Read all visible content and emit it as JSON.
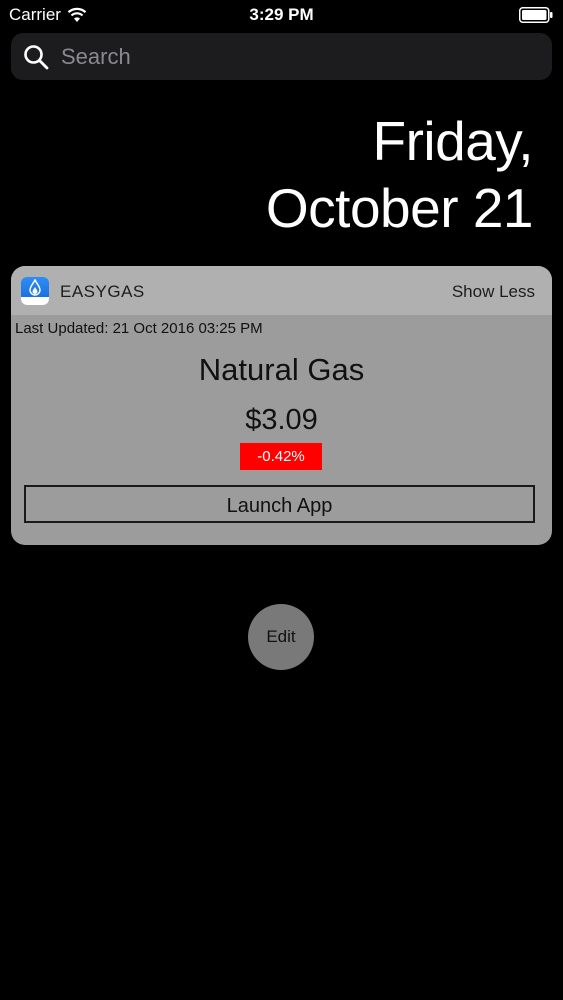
{
  "status_bar": {
    "carrier": "Carrier",
    "time": "3:29 PM",
    "wifi_icon": "wifi-icon",
    "battery_icon": "battery-icon",
    "battery_level": 1.0
  },
  "search": {
    "placeholder": "Search",
    "icon": "search-icon"
  },
  "date": {
    "weekday": "Friday,",
    "month_day": "October 21"
  },
  "widget": {
    "app_icon": "gas-price-app-icon",
    "app_name": "EASYGAS",
    "show_less_label": "Show Less",
    "last_updated": "Last Updated: 21 Oct 2016 03:25 PM",
    "commodity": "Natural Gas",
    "price": "$3.09",
    "change": "-0.42%",
    "change_color": "#ff0000",
    "launch_label": "Launch App"
  },
  "edit_label": "Edit"
}
